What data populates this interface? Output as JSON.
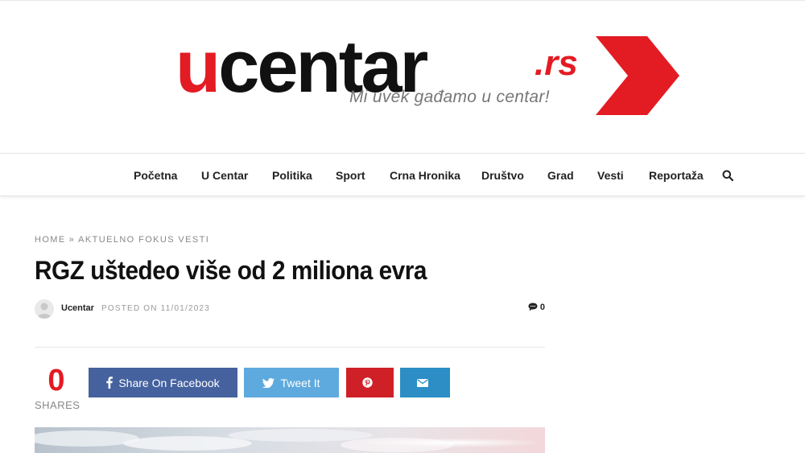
{
  "logo": {
    "first": "u",
    "rest": "centar",
    "domain": ".rs",
    "tagline": "Mi uvek gađamo u centar!"
  },
  "nav": {
    "items": [
      {
        "label": "Početna"
      },
      {
        "label": "U Centar"
      },
      {
        "label": "Politika"
      },
      {
        "label": "Sport"
      },
      {
        "label": "Crna Hronika"
      },
      {
        "label": "Društvo"
      },
      {
        "label": "Grad"
      },
      {
        "label": "Vesti"
      },
      {
        "label": "Reportaža"
      }
    ],
    "search_icon": "search-icon"
  },
  "breadcrumb": {
    "home": "HOME",
    "separator": "»",
    "category": "AKTUELNO FOKUS VESTI"
  },
  "article": {
    "title": "RGZ uštedeo više od 2 miliona evra",
    "author": "Ucentar",
    "posted_label": "POSTED ON",
    "date": "11/01/2023",
    "comment_count": "0"
  },
  "share": {
    "count": "0",
    "label": "SHARES",
    "facebook_label": "Share On Facebook",
    "twitter_label": "Tweet It"
  },
  "colors": {
    "brand_red": "#e31b23",
    "facebook": "#45629f",
    "twitter": "#5eaade",
    "pinterest": "#cf2027",
    "email": "#2c8ec4"
  }
}
